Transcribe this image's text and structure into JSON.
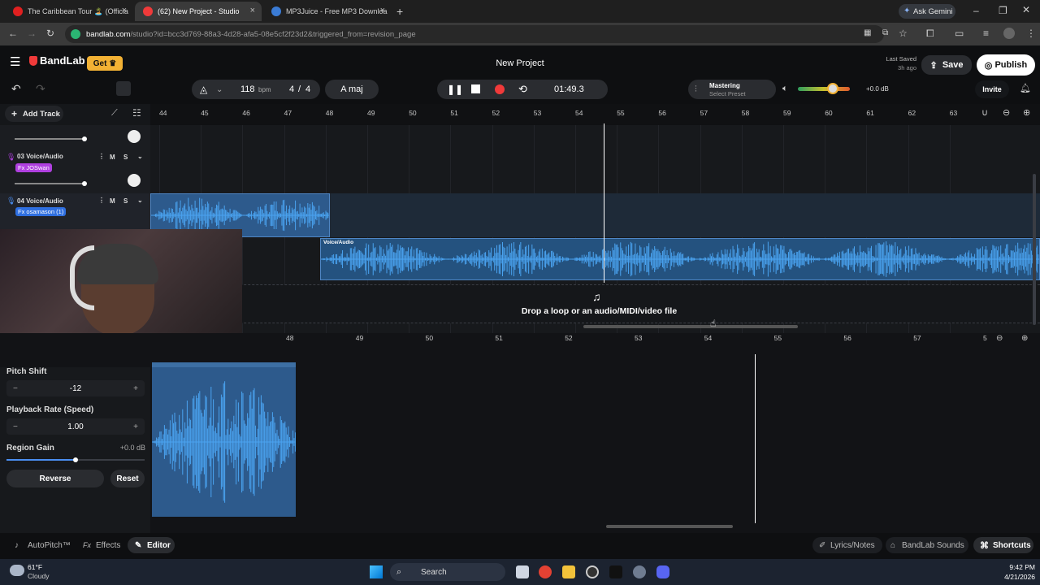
{
  "browser": {
    "tabs": [
      {
        "title": "The Caribbean Tour 🏝️ (Officia",
        "close": "×"
      },
      {
        "title": "(62) New Project - Studio",
        "close": "×"
      },
      {
        "title": "MP3Juice - Free MP3 Downloa",
        "close": "×"
      }
    ],
    "new_tab": "+",
    "ask_gemini": "Ask Gemini",
    "url_host": "bandlab.com",
    "url_rest": "/studio?id=bcc3d769-88a3-4d28-afa5-08e5cf2f23d2&triggered_from=revision_page"
  },
  "app": {
    "brand": "BandLab",
    "get_label": "Get",
    "project_title": "New Project",
    "last_saved_label": "Last Saved",
    "last_saved_time": "3h ago",
    "save_label": "Save",
    "publish_label": "Publish",
    "invite_label": "Invite"
  },
  "toolbar": {
    "tempo": "118",
    "tempo_unit": "bpm",
    "time_sig_num": "4",
    "time_sig_sep": "/",
    "time_sig_den": "4",
    "key": "A maj",
    "time": "01:49.3",
    "mastering_label": "Mastering",
    "mastering_preset": "Select Preset",
    "master_volume": "+0.0 dB"
  },
  "tracks": {
    "add_track": "Add Track",
    "items": [
      {
        "name": "03  Voice/Audio",
        "fx": "Fx JOSwan",
        "m": "M",
        "s": "S"
      },
      {
        "name": "04  Voice/Audio",
        "fx": "Fx osamason (1)",
        "m": "M",
        "s": "S"
      }
    ],
    "clip_label": "Voice/Audio",
    "drop_hint": "Drop a loop or an audio/MIDI/video file"
  },
  "ruler": {
    "top_ticks": [
      "44",
      "45",
      "46",
      "47",
      "48",
      "49",
      "50",
      "51",
      "52",
      "53",
      "54",
      "55",
      "56",
      "57",
      "58",
      "59",
      "60",
      "61",
      "62",
      "63"
    ],
    "editor_ticks": [
      "48",
      "49",
      "50",
      "51",
      "52",
      "53",
      "54",
      "55",
      "56",
      "57",
      "5"
    ]
  },
  "editor_panel": {
    "pitch_label": "Pitch Shift",
    "pitch_value": "-12",
    "rate_label": "Playback Rate (Speed)",
    "rate_value": "1.00",
    "gain_label": "Region Gain",
    "gain_value": "+0.0 dB",
    "reverse_label": "Reverse",
    "reset_label": "Reset",
    "minus": "−",
    "plus": "+"
  },
  "bottom_tabs": {
    "autopitch": "AutoPitch™",
    "effects": "Effects",
    "editor": "Editor",
    "lyrics": "Lyrics/Notes",
    "sounds": "BandLab Sounds",
    "shortcuts": "Shortcuts"
  },
  "taskbar": {
    "temp": "61°F",
    "weather": "Cloudy",
    "search": "Search",
    "time": "9:42 PM",
    "date": "4/21/2026"
  },
  "colors": {
    "accent_red": "#f03a3a",
    "clip_blue": "#2d5a8c",
    "wave_blue": "#4aa3f0",
    "get_badge": "#f2b134",
    "fx_purple": "#b040e0",
    "fx_blue": "#2f6fe0"
  }
}
